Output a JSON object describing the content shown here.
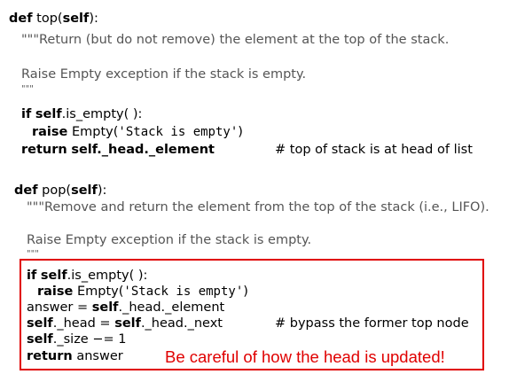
{
  "top_method": {
    "def_kw": "def",
    "name_open": " top(",
    "self_kw": "self",
    "name_close": "):",
    "doc_line1": "\"\"\"Return (but do not remove) the element at the top of the stack.",
    "doc_line2": "Raise Empty exception if the stack is empty.",
    "doc_close": "\"\"\"",
    "if_kw": "if",
    "if_self": "self",
    "if_rest": ".is_empty( ):",
    "raise_kw": "raise",
    "raise_name": " Empty(",
    "raise_str": "'Stack is empty'",
    "raise_close": ")",
    "return_kw": "return",
    "return_self": "self",
    "return_rest": "._head._element",
    "return_comment": "# top of stack is at head of list"
  },
  "pop_method": {
    "def_kw": "def",
    "name_open": " pop(",
    "self_kw": "self",
    "name_close": "):",
    "doc_line1": "\"\"\"Remove and return the element from the top of the stack (i.e., LIFO).",
    "doc_line2": "Raise Empty exception if the stack is empty.",
    "doc_close": "\"\"\"",
    "if_kw": "if",
    "if_self": "self",
    "if_rest": ".is_empty( ):",
    "raise_kw": "raise",
    "raise_name": " Empty(",
    "raise_str": "'Stack is empty'",
    "raise_close": ")",
    "answer_lhs": "answer = ",
    "answer_self": "self",
    "answer_rest": "._head._element",
    "head_self": "self",
    "head_mid": "._head = ",
    "head_self2": "self",
    "head_rest": "._head._next",
    "head_comment": "# bypass the former top node",
    "size_self": "self",
    "size_rest": "._size −= 1",
    "return_kw": "return",
    "return_rest": " answer"
  },
  "annotation": {
    "note": "Be careful of how the head is updated!",
    "highlight_color": "#e00000"
  }
}
